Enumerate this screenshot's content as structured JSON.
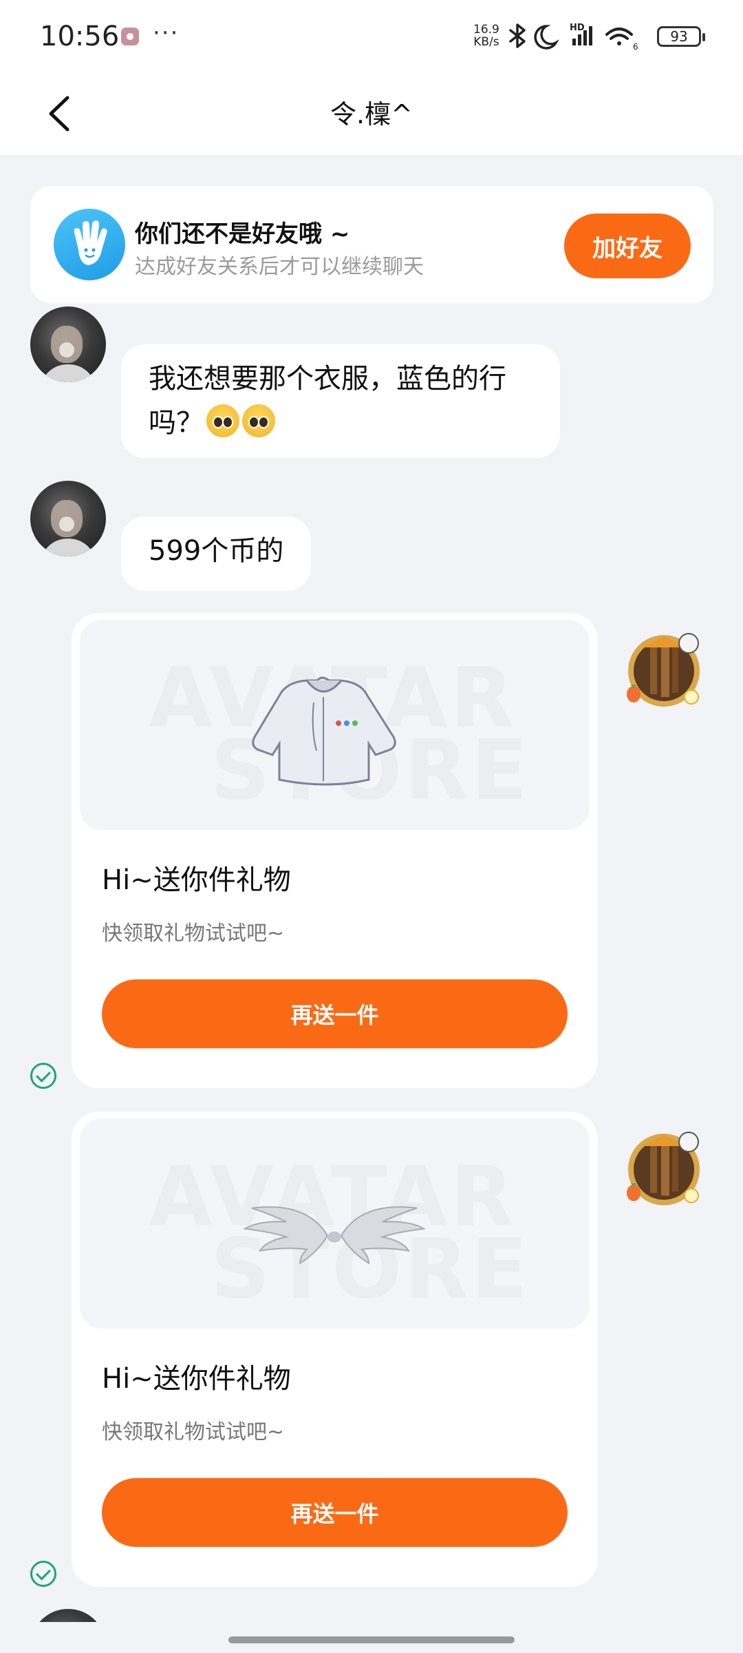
{
  "status_bar": {
    "time": "10:56",
    "more": "···",
    "net_speed_value": "16.9",
    "net_speed_unit": "KB/s",
    "signal_label": "HD",
    "wifi_label": "6",
    "battery": "93"
  },
  "header": {
    "title": "令.檁^"
  },
  "friend_banner": {
    "title": "你们还不是好友哦 ~",
    "subtitle": "达成好友关系后才可以继续聊天",
    "button_label": "加好友"
  },
  "messages": [
    {
      "text": "我还想要那个衣服，蓝色的行",
      "text_line2": "吗？"
    },
    {
      "text": "599个币的"
    }
  ],
  "gift_cards": [
    {
      "image_icon": "hoodie-icon",
      "title": "Hi~送你件礼物",
      "subtitle": "快领取礼物试试吧~",
      "button_label": "再送一件"
    },
    {
      "image_icon": "wings-icon",
      "title": "Hi~送你件礼物",
      "subtitle": "快领取礼物试试吧~",
      "button_label": "再送一件"
    }
  ],
  "colors": {
    "accent": "#fa6a14",
    "background": "#f1f3f6",
    "check": "#1aa86b"
  }
}
